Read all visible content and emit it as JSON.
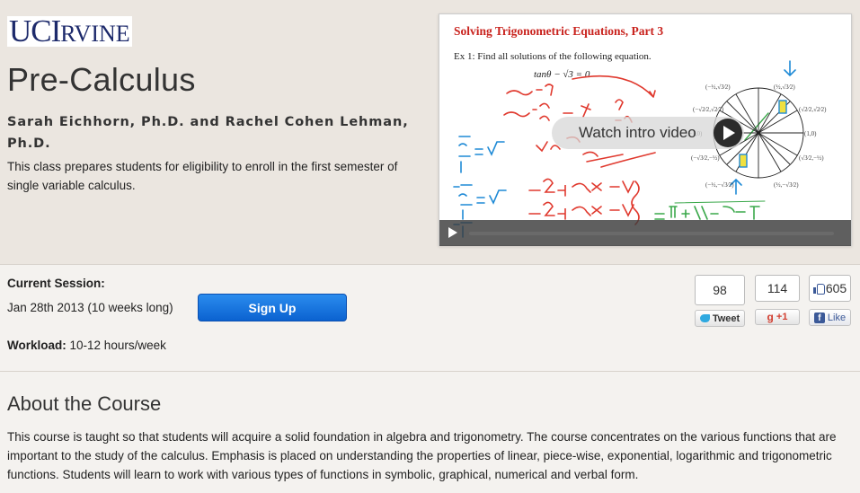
{
  "header": {
    "logo_big_1": "UC",
    "logo_big_2": "I",
    "logo_small": "RVINE",
    "course_title": "Pre-Calculus",
    "authors": "Sarah Eichhorn, Ph.D. and Rachel Cohen Lehman, Ph.D.",
    "description": "This class prepares students for eligibility to enroll in the first semester of single variable calculus."
  },
  "video": {
    "slide_title": "Solving Trigonometric Equations, Part 3",
    "slide_subtitle": "Ex 1: Find all solutions of the following equation.",
    "equation": "tanθ − √3 = 0",
    "intro_label": "Watch intro video"
  },
  "session": {
    "current_label": "Current Session:",
    "date_text": "Jan 28th 2013 (10 weeks long)",
    "signup_label": "Sign Up",
    "workload_label": "Workload:",
    "workload_value": "10-12 hours/week"
  },
  "social": {
    "tweet_count": "98",
    "tweet_label": "Tweet",
    "plusone_count": "114",
    "plusone_label": "+1",
    "like_count": "605",
    "like_label": "Like",
    "colors": {
      "twitter": "#2fa9e0",
      "google": "#d23f31",
      "facebook": "#3b5998"
    }
  },
  "about": {
    "heading": "About the Course",
    "body": "This course is taught so that students will acquire a solid foundation in algebra and trigonometry. The course concentrates on the various functions that are important to the study of the calculus. Emphasis is placed on understanding the properties of linear, piece-wise, exponential, logarithmic and trigonometric functions. Students will learn to work with various types of functions in symbolic, graphical, numerical and verbal form."
  },
  "colors": {
    "accent": "#1572e0",
    "brand": "#1d2a6b",
    "slide_title": "#c9231e"
  }
}
